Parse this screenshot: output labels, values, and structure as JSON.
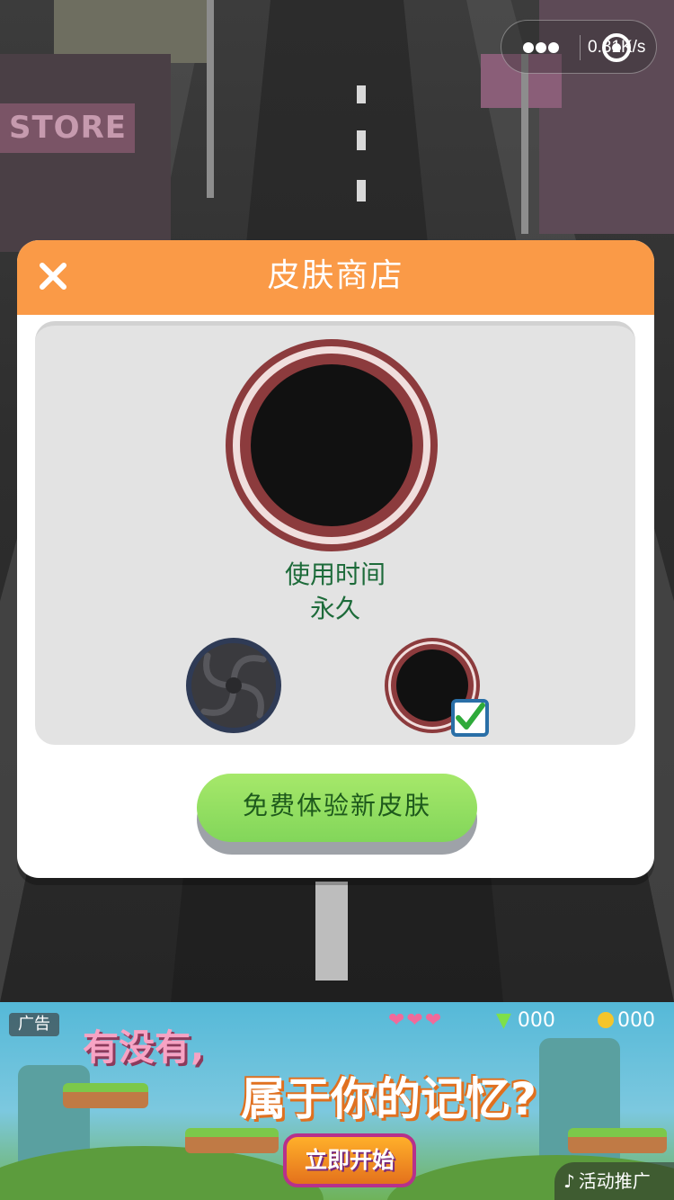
{
  "status": {
    "network_speed": "0.31K/s"
  },
  "scene": {
    "store_sign": "STORE"
  },
  "modal": {
    "title": "皮肤商店",
    "close_icon": "close-icon",
    "preview": {
      "use_time_label": "使用时间",
      "use_time_value": "永久"
    },
    "skins": [
      {
        "name": "vortex",
        "selected": false
      },
      {
        "name": "classic-red-ring",
        "selected": true
      }
    ],
    "cta_label": "免费体验新皮肤"
  },
  "ad": {
    "badge": "广告",
    "headline_1": "有没有,",
    "headline_2": "属于你的记忆?",
    "hearts": "❤❤❤",
    "gem_count": "000",
    "coin_count": "000",
    "start_label": "立即开始",
    "promo_label": "活动推广"
  },
  "colors": {
    "header": "#fa9a47",
    "panel": "#e3e3e3",
    "ring": "#8c3b3d",
    "text_green": "#1d6b3a",
    "cta": "#8fdc5e",
    "check_border": "#2a6fa7",
    "check_mark": "#2eaa3a"
  }
}
